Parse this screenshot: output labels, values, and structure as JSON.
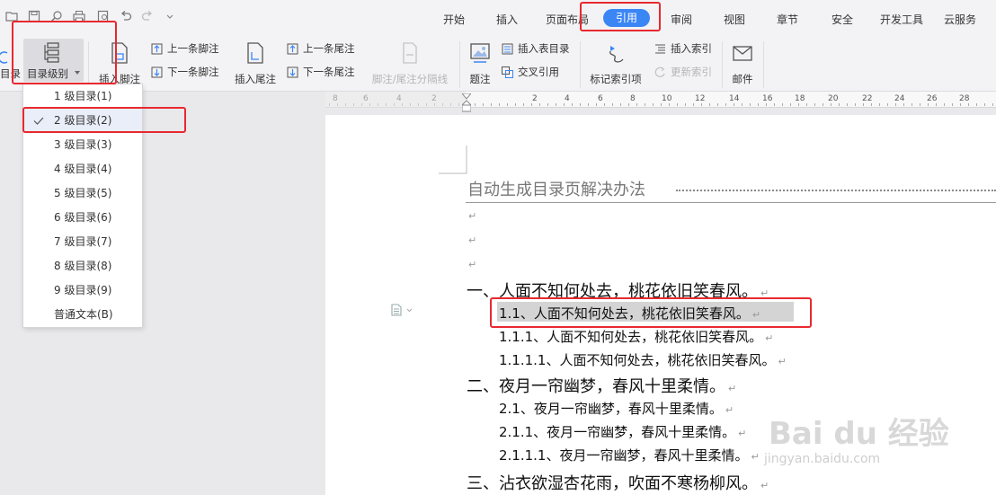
{
  "menu_tabs": [
    "开始",
    "插入",
    "页面布局",
    "引用",
    "审阅",
    "视图",
    "章节",
    "安全",
    "开发工具",
    "云服务"
  ],
  "active_tab": "引用",
  "ribbon": {
    "toc_partial": "目录",
    "toc_level": "目录级别",
    "insert_footnote": "插入脚注",
    "prev_footnote": "上一条脚注",
    "next_footnote": "下一条脚注",
    "insert_endnote": "插入尾注",
    "prev_endnote": "上一条尾注",
    "next_endnote": "下一条尾注",
    "separator_line": "脚注/尾注分隔线",
    "caption": "题注",
    "insert_table_of_figures": "插入表目录",
    "cross_reference": "交叉引用",
    "mark_index_entry": "标记索引项",
    "insert_index": "插入索引",
    "update_index": "更新索引",
    "mail": "邮件"
  },
  "dropdown": {
    "items": [
      "1 级目录(1)",
      "2 级目录(2)",
      "3 级目录(3)",
      "4 级目录(4)",
      "5 级目录(5)",
      "6 级目录(6)",
      "7 级目录(7)",
      "8 级目录(8)",
      "9 级目录(9)",
      "普通文本(B)"
    ],
    "selected": "2 级目录(2)"
  },
  "ruler": {
    "numbers": [
      "8",
      "6",
      "4",
      "2",
      "2",
      "4",
      "6",
      "8",
      "10",
      "12",
      "14",
      "16",
      "18",
      "20",
      "22",
      "24",
      "26",
      "28",
      "30",
      "32",
      "34",
      "36",
      "38"
    ]
  },
  "document": {
    "toc_title": "自动生成目录页解决办法",
    "lines": [
      "一、人面不知何处去，桃花依旧笑春风。",
      "1.1、人面不知何处去，桃花依旧笑春风。",
      "1.1.1、人面不知何处去，桃花依旧笑春风。",
      "1.1.1.1、人面不知何处去，桃花依旧笑春风。",
      "二、夜月一帘幽梦，春风十里柔情。",
      "2.1、夜月一帘幽梦，春风十里柔情。",
      "2.1.1、夜月一帘幽梦，春风十里柔情。",
      "2.1.1.1、夜月一帘幽梦，春风十里柔情。",
      "三、沾衣欲湿杏花雨，吹面不寒杨柳风。"
    ],
    "return_mark": "↵"
  },
  "watermark": {
    "brand": "Bai du 经验",
    "url": "jingyan.baidu.com"
  },
  "colors": {
    "accent": "#3b86f5",
    "highlight_box": "#e8292f",
    "selection": "#d4d4d4"
  }
}
